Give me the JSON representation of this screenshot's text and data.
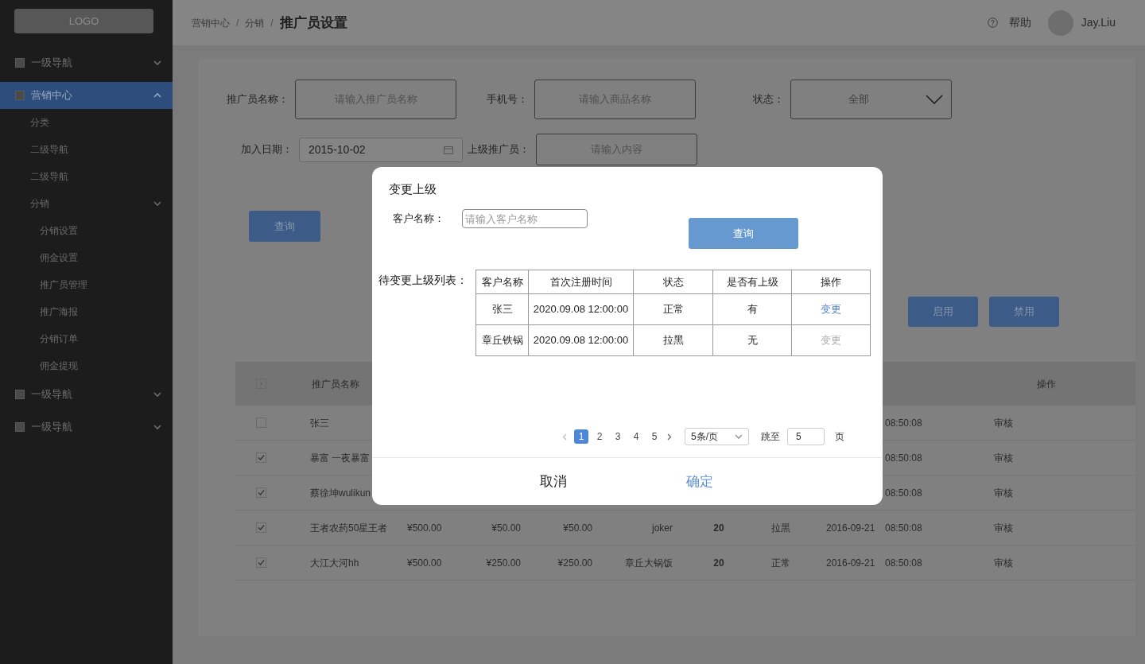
{
  "sidebar": {
    "logo": "LOGO",
    "items": [
      {
        "label": "一级导航",
        "selected": false,
        "expanded": false
      },
      {
        "label": "营销中心",
        "selected": true,
        "expanded": true,
        "children": [
          {
            "label": "分类"
          },
          {
            "label": "二级导航"
          },
          {
            "label": "二级导航"
          },
          {
            "label": "分销",
            "children": [
              {
                "label": "分销设置"
              },
              {
                "label": "佣金设置"
              },
              {
                "label": "推广员管理"
              },
              {
                "label": "推广海报"
              },
              {
                "label": "分销订单"
              },
              {
                "label": "佣金提现"
              }
            ]
          }
        ]
      },
      {
        "label": "一级导航",
        "selected": false,
        "expanded": false
      },
      {
        "label": "一级导航",
        "selected": false,
        "expanded": false
      }
    ]
  },
  "header": {
    "breadcrumb": [
      {
        "label": "营销中心",
        "separator": "/"
      },
      {
        "label": "分销",
        "separator": "/"
      }
    ],
    "title": "推广员设置",
    "help": "帮助",
    "user": "Jay.Liu"
  },
  "filters": [
    {
      "kind": "input",
      "label": "推广员名称：",
      "placeholder": "请输入推广员名称"
    },
    {
      "kind": "input",
      "label": "手机号：",
      "placeholder": "请输入商品名称"
    },
    {
      "kind": "select",
      "label": "状态：",
      "value": "全部"
    },
    {
      "kind": "date",
      "label": "加入日期：",
      "value": "2015-10-02"
    },
    {
      "kind": "input",
      "label": "上级推广员：",
      "placeholder": "请输入内容"
    }
  ],
  "search_button": "查询",
  "action_buttons": [
    "启用",
    "禁用"
  ],
  "table": {
    "select_all": {
      "indeterminate": true
    },
    "columns": [
      "推广员名称",
      "操作"
    ],
    "rows": [
      {
        "checked": false,
        "name": "张三",
        "time": "08:50:08",
        "action": "审核"
      },
      {
        "checked": true,
        "name": "暴富 一夜暴富",
        "time": "08:50:08",
        "action": "审核"
      },
      {
        "checked": true,
        "name": "蔡徐坤wulikun",
        "time": "08:50:08",
        "action": "审核"
      },
      {
        "checked": true,
        "name": "王者农药50星王者",
        "cells": [
          "¥500.00",
          "¥50.00",
          "¥50.00",
          "joker",
          "20",
          "拉黑"
        ],
        "date": "2016-09-21",
        "time": "08:50:08",
        "action": "审核"
      },
      {
        "checked": true,
        "name": "大江大河hh",
        "cells": [
          "¥500.00",
          "¥250.00",
          "¥250.00",
          "章丘大锅饭",
          "20",
          "正常"
        ],
        "date": "2016-09-21",
        "time": "08:50:08",
        "action": "审核"
      }
    ]
  },
  "modal": {
    "title": "变更上级",
    "field_label": "客户名称：",
    "placeholder": "请输入客户名称",
    "search_button": "查询",
    "list_label": "待变更上级列表：",
    "columns": [
      "客户名称",
      "首次注册时间",
      "状态",
      "是否有上级",
      "操作"
    ],
    "rows": [
      {
        "cells": [
          "张三",
          "2020.09.08 12:00:00",
          "正常",
          "有"
        ],
        "action": "变更",
        "disabled": false
      },
      {
        "cells": [
          "章丘铁锅",
          "2020.09.08 12:00:00",
          "拉黑",
          "无"
        ],
        "action": "变更",
        "disabled": true
      }
    ],
    "pagination": {
      "pages": [
        {
          "label": "1",
          "selected": true
        },
        {
          "label": "2",
          "selected": false
        },
        {
          "label": "3",
          "selected": false
        },
        {
          "label": "4",
          "selected": false
        },
        {
          "label": "5",
          "selected": false
        }
      ],
      "page_size": "5条/页",
      "jump_label": "跳至",
      "jump_value": "5",
      "page_suffix": "页"
    },
    "cancel": "取消",
    "confirm": "确定"
  }
}
